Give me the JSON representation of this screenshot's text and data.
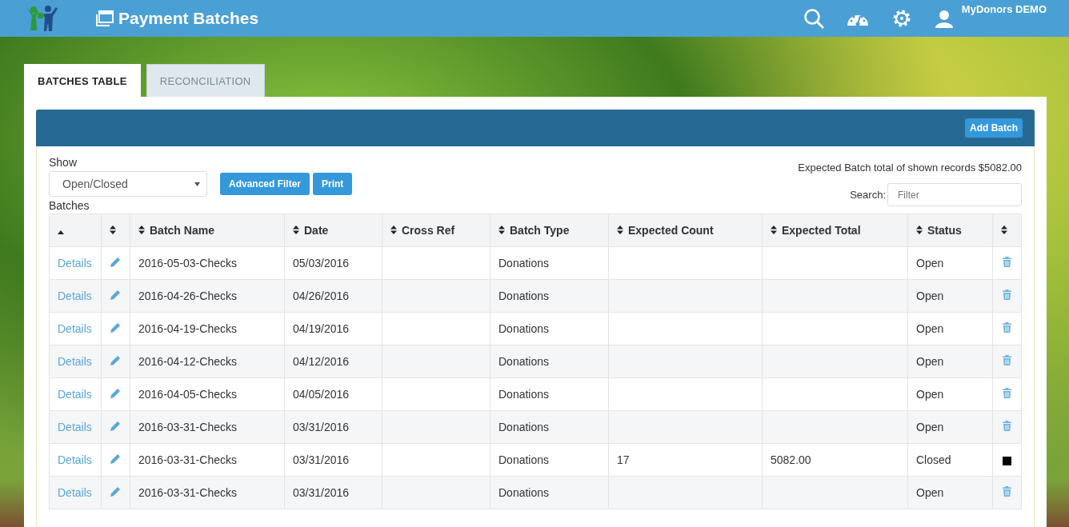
{
  "app_bar": {
    "title": "Payment Batches",
    "user": "MyDonors DEMO"
  },
  "tabs": [
    {
      "label": "BATCHES TABLE",
      "selected": true
    },
    {
      "label": "RECONCILIATION",
      "selected": false
    }
  ],
  "panel": {
    "add_button": "Add Batch"
  },
  "filters": {
    "show_label": "Show",
    "show_value": "Open/Closed",
    "buttons": [
      "Advanced Filter",
      "Print"
    ],
    "summary": "Expected Batch total of shown records $5082.00",
    "search_label": "Search:",
    "search_placeholder": "Filter",
    "table_caption": "Batches"
  },
  "table": {
    "columns": [
      {
        "sorted": true
      },
      {
        "sorted": false
      },
      {
        "label": "Batch Name",
        "sorted": false
      },
      {
        "label": "Date",
        "sorted": false
      },
      {
        "label": "Cross Ref",
        "sorted": false
      },
      {
        "label": "Batch Type",
        "sorted": false
      },
      {
        "label": "Expected Count",
        "sorted": false
      },
      {
        "label": "Expected Total",
        "sorted": false
      },
      {
        "label": "Status",
        "sorted": false
      },
      {
        "sorted": false
      }
    ],
    "rows": [
      {
        "link": "Details",
        "name": "2016-05-03-Checks",
        "date": "05/03/2016",
        "type": "Donations",
        "status": "Open",
        "deletable": true
      },
      {
        "link": "Details",
        "name": "2016-04-26-Checks",
        "date": "04/26/2016",
        "type": "Donations",
        "status": "Open",
        "deletable": true
      },
      {
        "link": "Details",
        "name": "2016-04-19-Checks",
        "date": "04/19/2016",
        "type": "Donations",
        "status": "Open",
        "deletable": true
      },
      {
        "link": "Details",
        "name": "2016-04-12-Checks",
        "date": "04/12/2016",
        "type": "Donations",
        "status": "Open",
        "deletable": true
      },
      {
        "link": "Details",
        "name": "2016-04-05-Checks",
        "date": "04/05/2016",
        "type": "Donations",
        "status": "Open",
        "deletable": true
      },
      {
        "link": "Details",
        "name": "2016-03-31-Checks",
        "date": "03/31/2016",
        "type": "Donations",
        "status": "Open",
        "deletable": true
      },
      {
        "link": "Details",
        "name": "2016-03-31-Checks",
        "date": "03/31/2016",
        "type": "Donations",
        "count": "17",
        "total": "5082.00",
        "status": "Closed",
        "deletable": false
      },
      {
        "link": "Details",
        "name": "2016-03-31-Checks",
        "date": "03/31/2016",
        "type": "Donations",
        "status": "Open",
        "deletable": true
      }
    ]
  }
}
